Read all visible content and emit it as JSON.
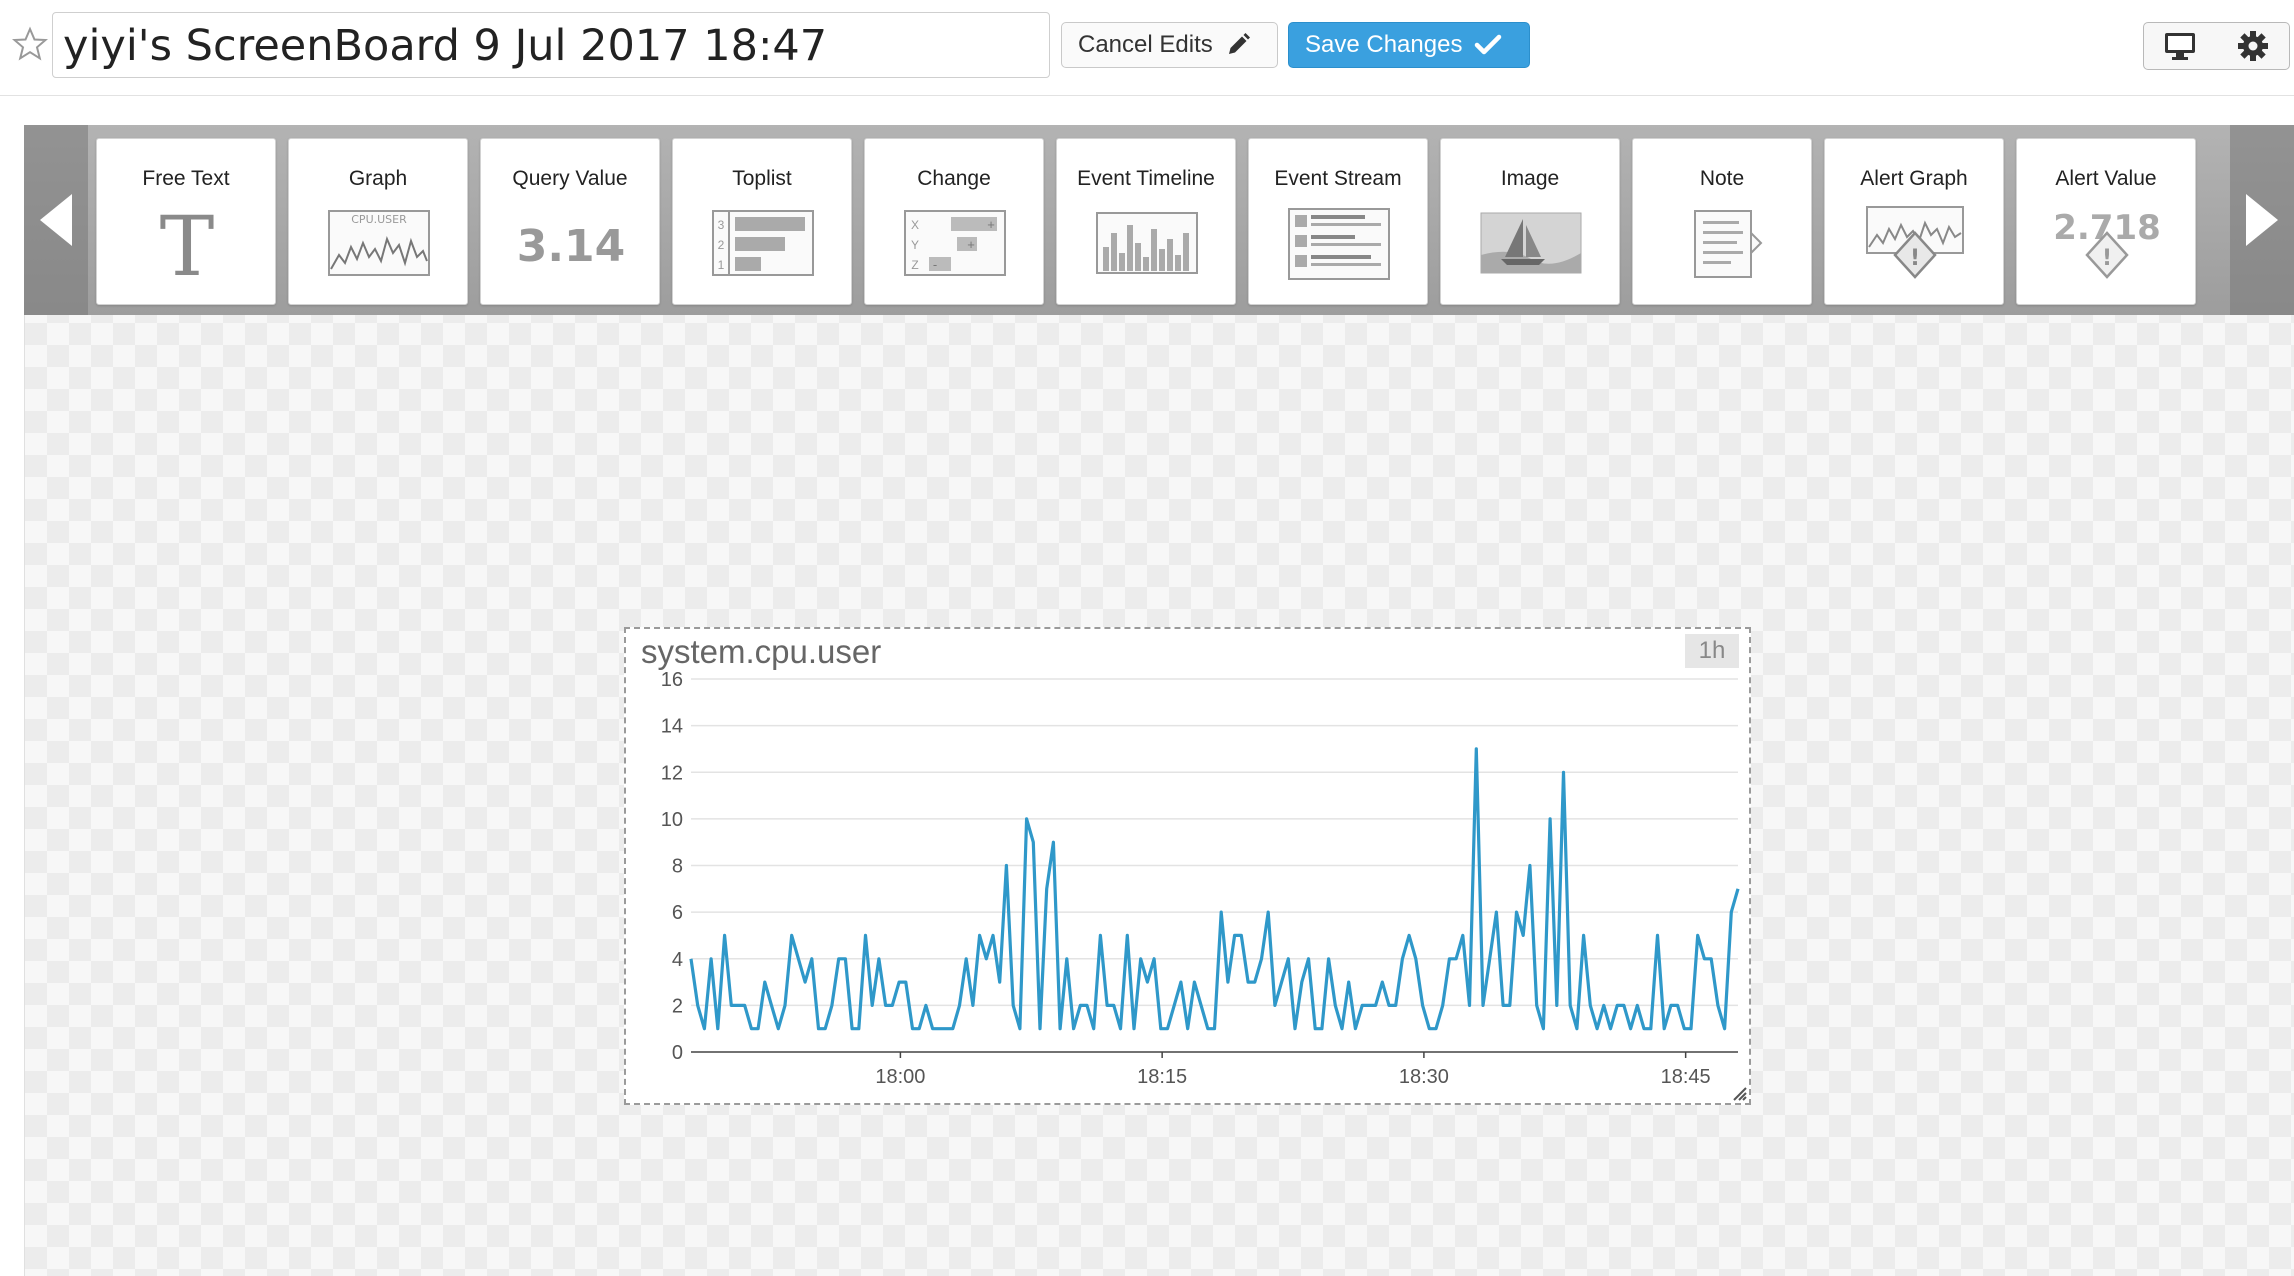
{
  "header": {
    "title": "yiyi's ScreenBoard 9 Jul 2017 18:47",
    "cancel_label": "Cancel Edits",
    "save_label": "Save Changes",
    "favorite_icon": "star-icon",
    "tv_icon": "monitor-icon",
    "settings_icon": "gear-icon"
  },
  "toolbar": {
    "widgets": [
      {
        "label": "Free Text",
        "icon": "free-text-icon"
      },
      {
        "label": "Graph",
        "icon": "graph-icon",
        "thumb_text": "CPU.USER"
      },
      {
        "label": "Query Value",
        "icon": "query-value-icon",
        "thumb_text": "3.14"
      },
      {
        "label": "Toplist",
        "icon": "toplist-icon"
      },
      {
        "label": "Change",
        "icon": "change-icon"
      },
      {
        "label": "Event Timeline",
        "icon": "event-timeline-icon"
      },
      {
        "label": "Event Stream",
        "icon": "event-stream-icon"
      },
      {
        "label": "Image",
        "icon": "image-icon"
      },
      {
        "label": "Note",
        "icon": "note-icon"
      },
      {
        "label": "Alert Graph",
        "icon": "alert-graph-icon"
      },
      {
        "label": "Alert Value",
        "icon": "alert-value-icon",
        "thumb_text": "2.718"
      }
    ]
  },
  "widget": {
    "title": "system.cpu.user",
    "timeframe": "1h"
  },
  "colors": {
    "accent": "#3aa0df",
    "line": "#2f98c9"
  },
  "chart_data": {
    "type": "line",
    "title": "system.cpu.user",
    "ylim": [
      0,
      16
    ],
    "yticks": [
      0,
      2,
      4,
      6,
      8,
      10,
      12,
      14,
      16
    ],
    "xticks": [
      "18:00",
      "18:15",
      "18:30",
      "18:45"
    ],
    "xlim": [
      "17:48",
      "18:48"
    ],
    "series": [
      {
        "x_start": "17:48",
        "x_step_minutes": 0.333,
        "values": [
          4,
          2,
          1,
          4,
          1,
          5,
          2,
          2,
          2,
          1,
          1,
          3,
          2,
          1,
          2,
          5,
          4,
          3,
          4,
          1,
          1,
          2,
          4,
          4,
          1,
          1,
          5,
          2,
          4,
          2,
          2,
          3,
          3,
          1,
          1,
          2,
          1,
          1,
          1,
          1,
          2,
          4,
          2,
          5,
          4,
          5,
          3,
          8,
          2,
          1,
          10,
          9,
          1,
          7,
          9,
          1,
          4,
          1,
          2,
          2,
          1,
          5,
          2,
          2,
          1,
          5,
          1,
          4,
          3,
          4,
          1,
          1,
          2,
          3,
          1,
          3,
          2,
          1,
          1,
          6,
          3,
          5,
          5,
          3,
          3,
          4,
          6,
          2,
          3,
          4,
          1,
          3,
          4,
          1,
          1,
          4,
          2,
          1,
          3,
          1,
          2,
          2,
          2,
          3,
          2,
          2,
          4,
          5,
          4,
          2,
          1,
          1,
          2,
          4,
          4,
          5,
          2,
          13,
          2,
          4,
          6,
          2,
          2,
          6,
          5,
          8,
          2,
          1,
          10,
          2,
          12,
          2,
          1,
          5,
          2,
          1,
          2,
          1,
          2,
          2,
          1,
          2,
          1,
          1,
          5,
          1,
          2,
          2,
          1,
          1,
          5,
          4,
          4,
          2,
          1,
          6,
          7
        ]
      }
    ]
  }
}
